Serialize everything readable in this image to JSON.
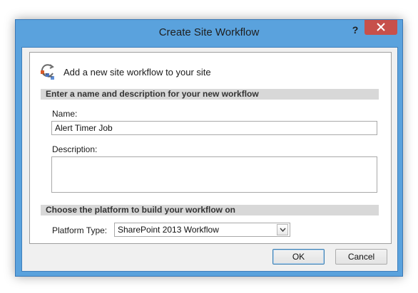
{
  "window": {
    "title": "Create Site Workflow",
    "help": "?"
  },
  "header": {
    "text": "Add a new site workflow to your site"
  },
  "sections": {
    "name_desc": "Enter a name and description for your new workflow",
    "platform": "Choose the platform to build your workflow on"
  },
  "fields": {
    "name_label": "Name:",
    "name_value": "Alert Timer Job",
    "description_label": "Description:",
    "description_value": "",
    "platform_label": "Platform Type:",
    "platform_value": "SharePoint 2013 Workflow"
  },
  "buttons": {
    "ok": "OK",
    "cancel": "Cancel"
  },
  "icons": {
    "workflow": "workflow-icon",
    "close": "close-icon",
    "dropdown": "chevron-down-icon"
  },
  "colors": {
    "title_bar": "#5aa2dd",
    "close_button": "#c7504b",
    "section_header": "#d8d8d8"
  }
}
